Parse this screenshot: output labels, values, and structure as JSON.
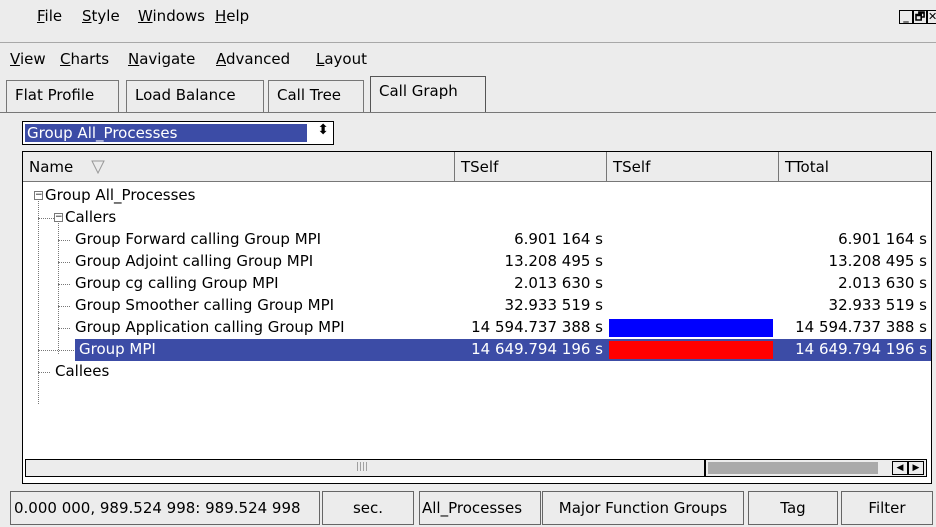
{
  "menu_top": [
    {
      "label": "File"
    },
    {
      "label": "Style"
    },
    {
      "label": "Windows"
    },
    {
      "label": "Help"
    }
  ],
  "menu_second": [
    {
      "label": "View"
    },
    {
      "label": "Charts"
    },
    {
      "label": "Navigate"
    },
    {
      "label": "Advanced"
    },
    {
      "label": "Layout"
    }
  ],
  "window_controls": {
    "minimize": "_",
    "restore": "🗗",
    "close": "✕"
  },
  "tabs": [
    {
      "label": "Flat Profile"
    },
    {
      "label": "Load Balance"
    },
    {
      "label": "Call Tree"
    },
    {
      "label": "Call Graph"
    }
  ],
  "group_select": {
    "value": "Group All_Processes"
  },
  "columns": [
    {
      "label": "Name"
    },
    {
      "label": "TSelf"
    },
    {
      "label": "TSelf"
    },
    {
      "label": "TTotal"
    }
  ],
  "rows": [
    {
      "name": "Group All_Processes",
      "tself": "",
      "ttotal": "",
      "bar": null
    },
    {
      "name": "Callers",
      "tself": "",
      "ttotal": "",
      "bar": null
    },
    {
      "name": "Group Forward calling Group MPI",
      "tself": "6.901 164 s",
      "ttotal": "6.901 164 s",
      "bar": null
    },
    {
      "name": "Group Adjoint calling Group MPI",
      "tself": "13.208 495 s",
      "ttotal": "13.208 495 s",
      "bar": null
    },
    {
      "name": "Group cg calling Group MPI",
      "tself": "2.013 630 s",
      "ttotal": "2.013 630 s",
      "bar": null
    },
    {
      "name": "Group Smoother calling Group MPI",
      "tself": "32.933 519 s",
      "ttotal": "32.933 519 s",
      "bar": null
    },
    {
      "name": "Group Application calling Group MPI",
      "tself": "14 594.737 388 s",
      "ttotal": "14 594.737 388 s",
      "bar": "#0000ff"
    },
    {
      "name": "Group MPI",
      "tself": "14 649.794 196 s",
      "ttotal": "14 649.794 196 s",
      "bar": "#ff0000"
    },
    {
      "name": "Callees",
      "tself": "",
      "ttotal": "",
      "bar": null
    }
  ],
  "status": [
    {
      "text": "0.000 000, 989.524 998: 989.524 998"
    },
    {
      "text": "sec."
    },
    {
      "text": "All_Processes"
    },
    {
      "text": "Major Function Groups"
    },
    {
      "text": "Tag"
    },
    {
      "text": "Filter"
    }
  ],
  "colors": {
    "selection": "#3c4ca6",
    "bar_application": "#0000ff",
    "bar_mpi": "#ff0000"
  }
}
